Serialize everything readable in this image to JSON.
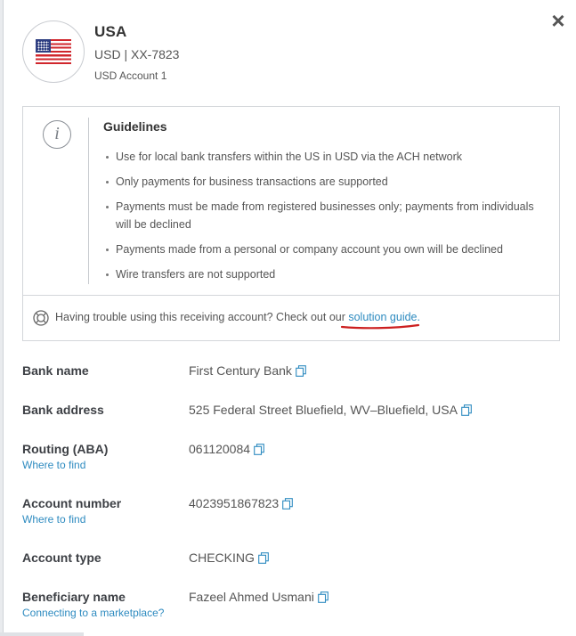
{
  "header": {
    "country": "USA",
    "currency_line": "USD | XX-7823",
    "account_name": "USD Account 1",
    "flag_icon": "us-flag-icon"
  },
  "close_icon": "close-icon",
  "guidelines": {
    "title": "Guidelines",
    "icon": "info-icon",
    "items": [
      "Use for local bank transfers within the US in USD via the ACH network",
      "Only payments for business transactions are supported",
      "Payments must be made from registered businesses only; payments from individuals will be declined",
      "Payments made from a personal or company account you own will be declined",
      "Wire transfers are not supported"
    ],
    "trouble_text": "Having trouble using this receiving account? Check out our ",
    "solution_link": "solution guide",
    "trouble_suffix": ".",
    "help_icon": "lifebuoy-icon",
    "highlight_color": "#cc1f1f"
  },
  "details": [
    {
      "label": "Bank name",
      "value": "First Century Bank",
      "sublink": ""
    },
    {
      "label": "Bank address",
      "value": "525 Federal Street Bluefield, WV–Bluefield, USA",
      "sublink": ""
    },
    {
      "label": "Routing (ABA)",
      "value": "061120084",
      "sublink": "Where to find"
    },
    {
      "label": "Account number",
      "value": "4023951867823",
      "sublink": "Where to find"
    },
    {
      "label": "Account type",
      "value": "CHECKING",
      "sublink": ""
    },
    {
      "label": "Beneficiary name",
      "value": "Fazeel Ahmed Usmani",
      "sublink": "Connecting to a marketplace?"
    }
  ],
  "colors": {
    "link": "#2e8bc0",
    "text": "#555555",
    "label": "#3c3f44",
    "border": "#d3d6da"
  }
}
